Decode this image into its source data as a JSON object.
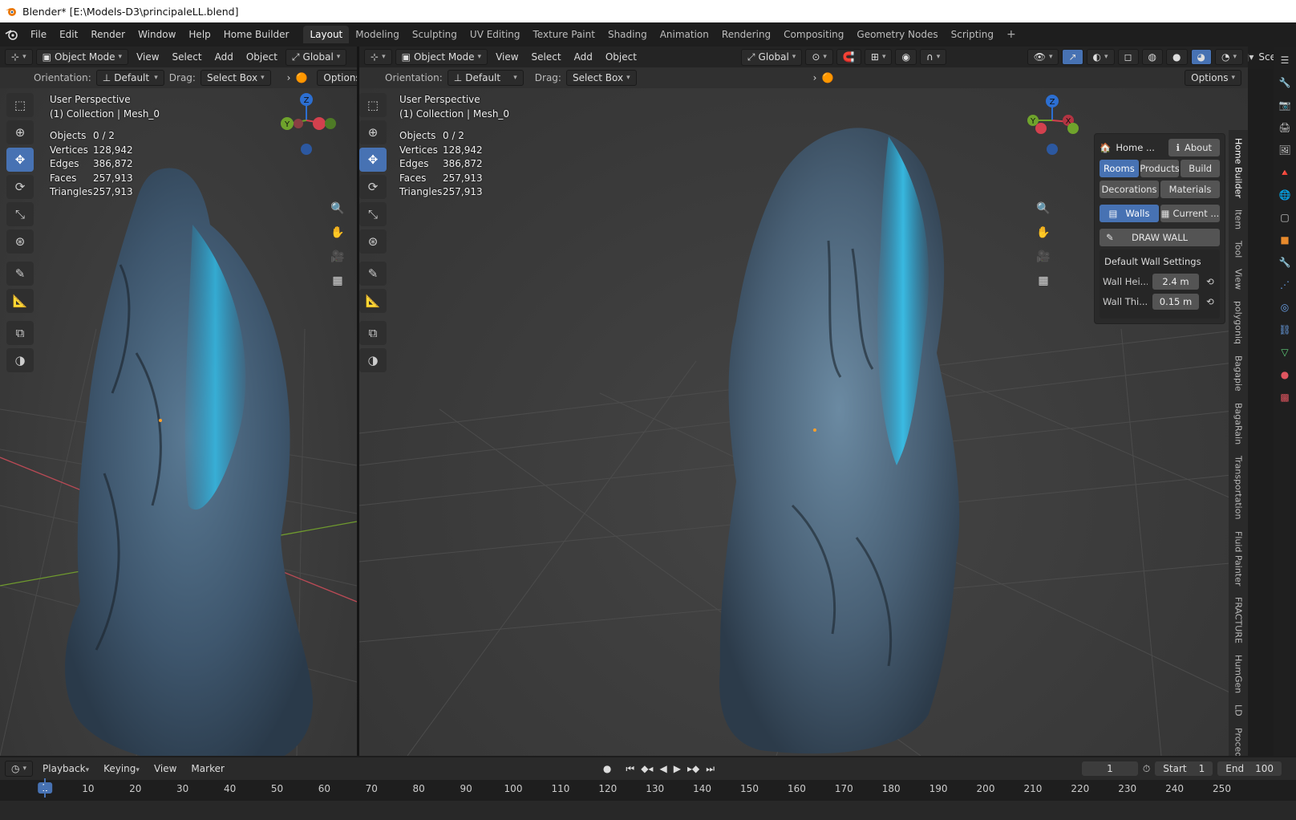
{
  "window": {
    "title": "Blender* [E:\\Models-D3\\principaleLL.blend]"
  },
  "menu": [
    "File",
    "Edit",
    "Render",
    "Window",
    "Help",
    "Home Builder"
  ],
  "workspaces": [
    "Layout",
    "Modeling",
    "Sculpting",
    "UV Editing",
    "Texture Paint",
    "Shading",
    "Animation",
    "Rendering",
    "Compositing",
    "Geometry Nodes",
    "Scripting"
  ],
  "active_workspace": "Layout",
  "scene_name": "Scene",
  "viewport_header": {
    "mode": "Object Mode",
    "menus": [
      "View",
      "Select",
      "Add",
      "Object"
    ],
    "transform": "Global",
    "orientation_label": "Orientation:",
    "orientation_value": "Default",
    "drag_label": "Drag:",
    "drag_value": "Select Box",
    "options": "Options"
  },
  "viewport_info": {
    "view_name": "User Perspective",
    "collection": "(1) Collection | Mesh_0",
    "stats": [
      {
        "k": "Objects",
        "v": "0 / 2"
      },
      {
        "k": "Vertices",
        "v": "128,942"
      },
      {
        "k": "Edges",
        "v": "386,872"
      },
      {
        "k": "Faces",
        "v": "257,913"
      },
      {
        "k": "Triangles",
        "v": "257,913"
      }
    ]
  },
  "gizmo_axes": {
    "x": "X",
    "y": "Y",
    "z": "Z"
  },
  "npanel": {
    "home": "Home ...",
    "about": "About",
    "tabs": [
      "Rooms",
      "Products",
      "Build"
    ],
    "tabs2": [
      "Decorations",
      "Materials"
    ],
    "walls": "Walls",
    "current": "Current ...",
    "draw_wall": "DRAW WALL",
    "settings_title": "Default Wall Settings",
    "wall_height_label": "Wall Hei...",
    "wall_height": "2.4 m",
    "wall_thickness_label": "Wall Thi...",
    "wall_thickness": "0.15 m"
  },
  "sidebar_tabs": [
    "Home Builder",
    "Item",
    "Tool",
    "View",
    "polygoniq",
    "Bagapie",
    "BagaRain",
    "Transportation",
    "Fluid Painter",
    "FRACTURE",
    "HumGen",
    "LD",
    "Procedural C"
  ],
  "timeline": {
    "menus": [
      "Playback",
      "Keying",
      "View",
      "Marker"
    ],
    "current_frame": "1",
    "start_label": "Start",
    "start": "1",
    "end_label": "End",
    "end": "100",
    "ticks": [
      "10",
      "20",
      "30",
      "40",
      "50",
      "60",
      "70",
      "80",
      "90",
      "100",
      "110",
      "120",
      "130",
      "140",
      "150",
      "160",
      "170",
      "180",
      "190",
      "200",
      "210",
      "220",
      "230",
      "240",
      "250"
    ]
  },
  "colors": {
    "accent": "#4772b3",
    "x_axis": "#d3414e",
    "y_axis": "#6fa32c",
    "z_axis": "#2c6fd2"
  }
}
